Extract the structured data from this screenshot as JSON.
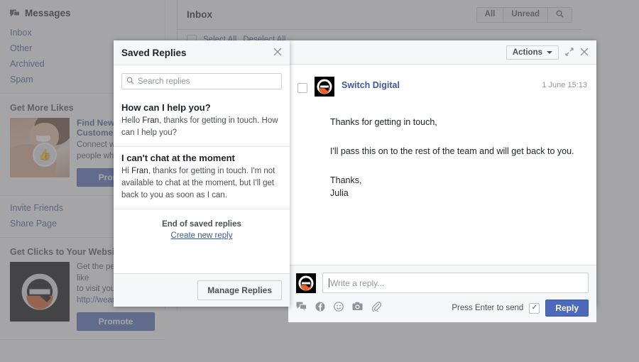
{
  "sidebar": {
    "messages_header": {
      "label": "Messages",
      "icon": "messages-icon"
    },
    "nav": [
      {
        "label": "Inbox"
      },
      {
        "label": "Other"
      },
      {
        "label": "Archived"
      },
      {
        "label": "Spam"
      }
    ],
    "promo_likes": {
      "section_title": "Get More Likes",
      "ad_title": "Find New Customers",
      "ad_text_line1": "Connect with more",
      "ad_text_line2": "people who matter",
      "button": "Promote",
      "thumb_icon": "thumbs-up-icon"
    },
    "links": [
      {
        "label": "Invite Friends"
      },
      {
        "label": "Share Page"
      }
    ],
    "promo_clicks": {
      "section_title": "Get Clicks to Your Website",
      "ad_text_line1": "Get the people who like",
      "ad_text_line2": "to visit your website",
      "ad_url": "http://weareswitchdigital.com",
      "button": "Promote",
      "thumb_icon": "switch-digital-logo"
    }
  },
  "inbox": {
    "title": "Inbox",
    "filters": [
      {
        "label": "All"
      },
      {
        "label": "Unread"
      },
      {
        "label": "",
        "icon": "search-icon"
      }
    ],
    "select_all": "Select All",
    "deselect_all": "Deselect All"
  },
  "conversation": {
    "actions_button": "Actions",
    "expand_icon": "expand-icon",
    "close_icon": "close-icon",
    "message": {
      "sender": "Switch Digital",
      "timestamp": "1 June 15:13",
      "avatar_icon": "switch-digital-logo",
      "paragraphs": [
        "Thanks for getting in touch,",
        "I'll pass this on to the rest of the team and will get back to you.",
        "Thanks,",
        "Julia"
      ]
    },
    "composer": {
      "avatar_icon": "switch-digital-logo",
      "placeholder": "Write a reply...",
      "value": "",
      "tools": [
        {
          "icon": "saved-replies-icon"
        },
        {
          "icon": "facebook-icon"
        },
        {
          "icon": "emoji-icon"
        },
        {
          "icon": "camera-icon"
        },
        {
          "icon": "attachment-icon"
        }
      ],
      "press_enter_label": "Press Enter to send",
      "press_enter_checked": true,
      "reply_button": "Reply"
    }
  },
  "saved_replies": {
    "title": "Saved Replies",
    "close_icon": "close-icon",
    "search_placeholder": "Search replies",
    "search_value": "",
    "search_icon": "search-icon",
    "items": [
      {
        "title": "How can I help you?",
        "snippet_pre": "Hello ",
        "snippet_name": "Fran",
        "snippet_post": ", thanks for getting in touch. How can I help you?"
      },
      {
        "title": "I can't chat at the moment",
        "snippet_pre": "Hi ",
        "snippet_name": "Fran",
        "snippet_post": ", thanks for getting in touch. I'm not available to chat at the moment, but I'll get back to you as soon as I can."
      }
    ],
    "end_text": "End of saved replies",
    "create_link": "Create new reply",
    "manage_button": "Manage Replies"
  },
  "colors": {
    "accent_blue": "#4c69ba",
    "link_blue": "#3b5998",
    "chrome_gray": "#f6f7f9",
    "border_gray": "#dcdee3",
    "overlay_gray": "#8b8b8d",
    "logo_orange": "#e8622a"
  }
}
